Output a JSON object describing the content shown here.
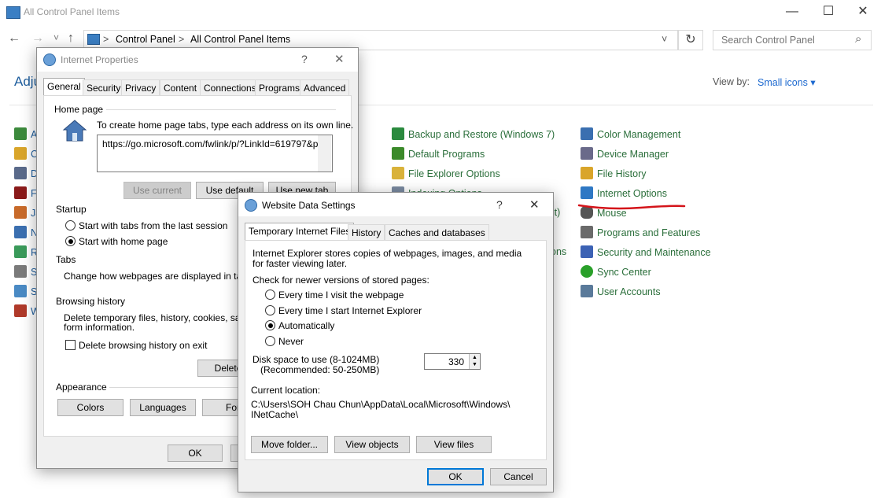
{
  "window": {
    "title": "All Control Panel Items",
    "minimize": "—",
    "maximize": "☐",
    "close": "✕"
  },
  "address": {
    "back": "←",
    "forward": "→",
    "recent": "˅",
    "up": "↑",
    "crumb1": "Control Panel",
    "crumb_sep": ">",
    "crumb2": "All Control Panel Items",
    "dropdown": "˅",
    "refresh": "↻",
    "search_placeholder": "Search Control Panel",
    "search_icon": "⌕"
  },
  "header": {
    "title_partial": "Adju",
    "view_by_label": "View by:",
    "view_by_value": "Small icons ▾"
  },
  "left_partial_items": [
    "A",
    "C",
    "D",
    "Fl",
    "Ja",
    "N",
    "Re",
    "So",
    "Sy",
    "W"
  ],
  "col2_items": [
    {
      "label": "Backup and Restore (Windows 7)",
      "color": "#2a8a3e"
    },
    {
      "label": "Default Programs",
      "color": "#3b8a2a"
    },
    {
      "label": "File Explorer Options",
      "color": "#d9b23a"
    },
    {
      "label": "Indexing Options",
      "color": "#7a8aa0"
    }
  ],
  "col2_partial": {
    "pbit": "pbit)",
    "ons": "ons"
  },
  "col3_items": [
    {
      "label": "Color Management",
      "color": "#3a6fb0"
    },
    {
      "label": "Device Manager",
      "color": "#6a6a8a"
    },
    {
      "label": "File History",
      "color": "#d9a52a"
    },
    {
      "label": "Internet Options",
      "color": "#2f78c4"
    },
    {
      "label": "Mouse",
      "color": "#555555"
    },
    {
      "label": "Programs and Features",
      "color": "#6a6a6a"
    },
    {
      "label": "Security and Maintenance",
      "color": "#3c62b4"
    },
    {
      "label": "Sync Center",
      "color": "#2aa02a"
    },
    {
      "label": "User Accounts",
      "color": "#5a7a9a"
    }
  ],
  "annotation_color": "#d4141a",
  "internet_properties": {
    "title": "Internet Properties",
    "help": "?",
    "close": "✕",
    "tabs": [
      "General",
      "Security",
      "Privacy",
      "Content",
      "Connections",
      "Programs",
      "Advanced"
    ],
    "home_page_label": "Home page",
    "home_desc": "To create home page tabs, type each address on its own line.",
    "home_url": "https://go.microsoft.com/fwlink/p/?LinkId=619797&p",
    "use_current": "Use current",
    "use_default": "Use default",
    "use_new_tab": "Use new tab",
    "startup_label": "Startup",
    "startup_opt1": "Start with tabs from the last session",
    "startup_opt2": "Start with home page",
    "tabs_label": "Tabs",
    "tabs_desc": "Change how webpages are displayed in tabs.",
    "browsing_label": "Browsing history",
    "browsing_desc1": "Delete temporary files, history, cookies, saved",
    "browsing_desc2": "form information.",
    "delete_on_exit": "Delete browsing history on exit",
    "delete_btn": "Delete",
    "appearance_label": "Appearance",
    "colors_btn": "Colors",
    "languages_btn": "Languages",
    "fonts_btn": "Font",
    "ok_btn": "OK"
  },
  "website_data": {
    "title": "Website Data Settings",
    "help": "?",
    "close": "✕",
    "tabs": [
      "Temporary Internet Files",
      "History",
      "Caches and databases"
    ],
    "desc1": "Internet Explorer stores copies of webpages, images, and media",
    "desc2": "for faster viewing later.",
    "check_label": "Check for newer versions of stored pages:",
    "opt1": "Every time I visit the webpage",
    "opt2": "Every time I start Internet Explorer",
    "opt3": "Automatically",
    "opt4": "Never",
    "disk_label1": "Disk space to use (8-1024MB)",
    "disk_label2": "(Recommended: 50-250MB)",
    "disk_value": "330",
    "current_location_label": "Current location:",
    "location1": "C:\\Users\\SOH Chau Chun\\AppData\\Local\\Microsoft\\Windows\\",
    "location2": "INetCache\\",
    "move_folder": "Move folder...",
    "view_objects": "View objects",
    "view_files": "View files",
    "ok": "OK",
    "cancel": "Cancel"
  }
}
